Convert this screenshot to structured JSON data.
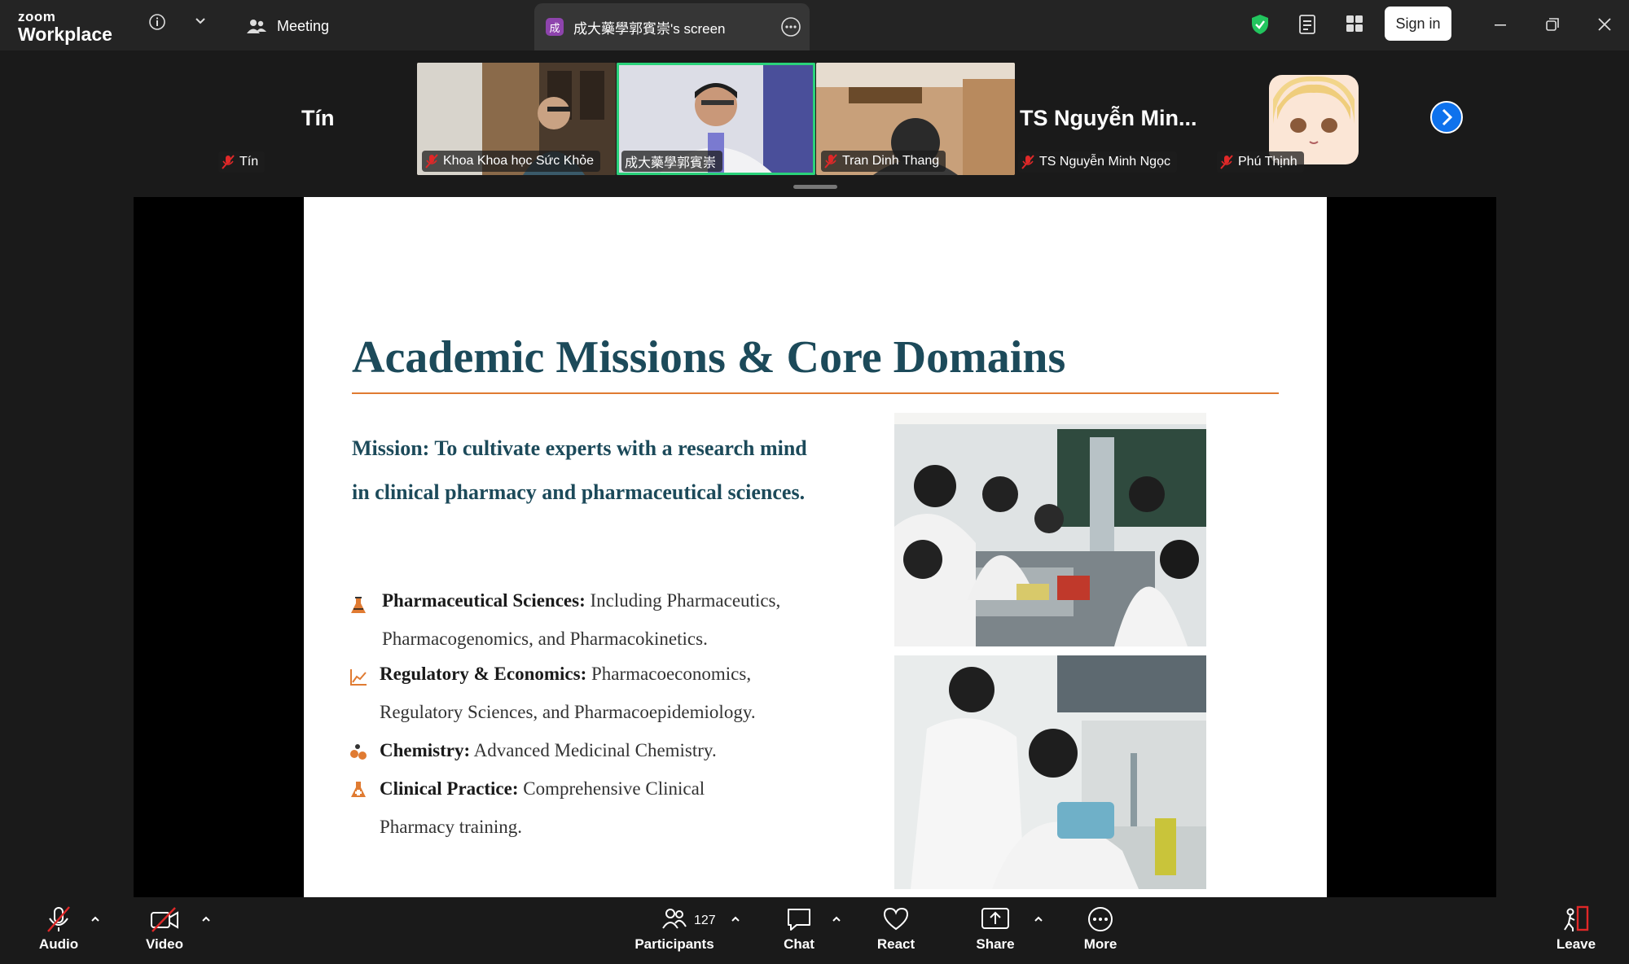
{
  "app": {
    "logo_top": "zoom",
    "logo_bottom": "Workplace"
  },
  "titlebar": {
    "meeting_label": "Meeting",
    "screen_badge": "成",
    "screen_tab": "成大藥學郭賓崇's screen",
    "sign_in": "Sign in",
    "security_color": "#22c55e"
  },
  "participants": {
    "left_big_name": "Tín",
    "left_tag": "Tín",
    "tiles": [
      {
        "name": "Khoa Khoa học Sức Khỏe"
      },
      {
        "name": "成大藥學郭賓崇"
      },
      {
        "name": "Tran Dinh Thang"
      }
    ],
    "right_big_name": "TS Nguyễn Min...",
    "right_tag": "TS Nguyễn Minh Ngọc",
    "last_tag": "Phú Thịnh"
  },
  "slide": {
    "title": "Academic Missions & Core Domains",
    "mission": "Mission: To cultivate experts with a research mind in clinical pharmacy and pharmaceutical sciences.",
    "bullets": [
      {
        "bold": "Pharmaceutical Sciences:",
        "line1": " Including Pharmaceutics,",
        "line2": "Pharmacogenomics, and Pharmacokinetics."
      },
      {
        "bold": "Regulatory & Economics:",
        "line1": " Pharmacoeconomics,",
        "line2": "Regulatory Sciences, and Pharmacoepidemiology."
      },
      {
        "bold": "Chemistry:",
        "line1": " Advanced Medicinal Chemistry.",
        "line2": ""
      },
      {
        "bold": "Clinical Practice:",
        "line1": " Comprehensive Clinical",
        "line2": "Pharmacy training."
      }
    ],
    "accent_color": "#e07b32",
    "title_color": "#1c4a5a"
  },
  "toolbar": {
    "audio": "Audio",
    "video": "Video",
    "participants": "Participants",
    "participants_count": "127",
    "chat": "Chat",
    "react": "React",
    "share": "Share",
    "more": "More",
    "leave": "Leave",
    "leave_color": "#e02828"
  }
}
